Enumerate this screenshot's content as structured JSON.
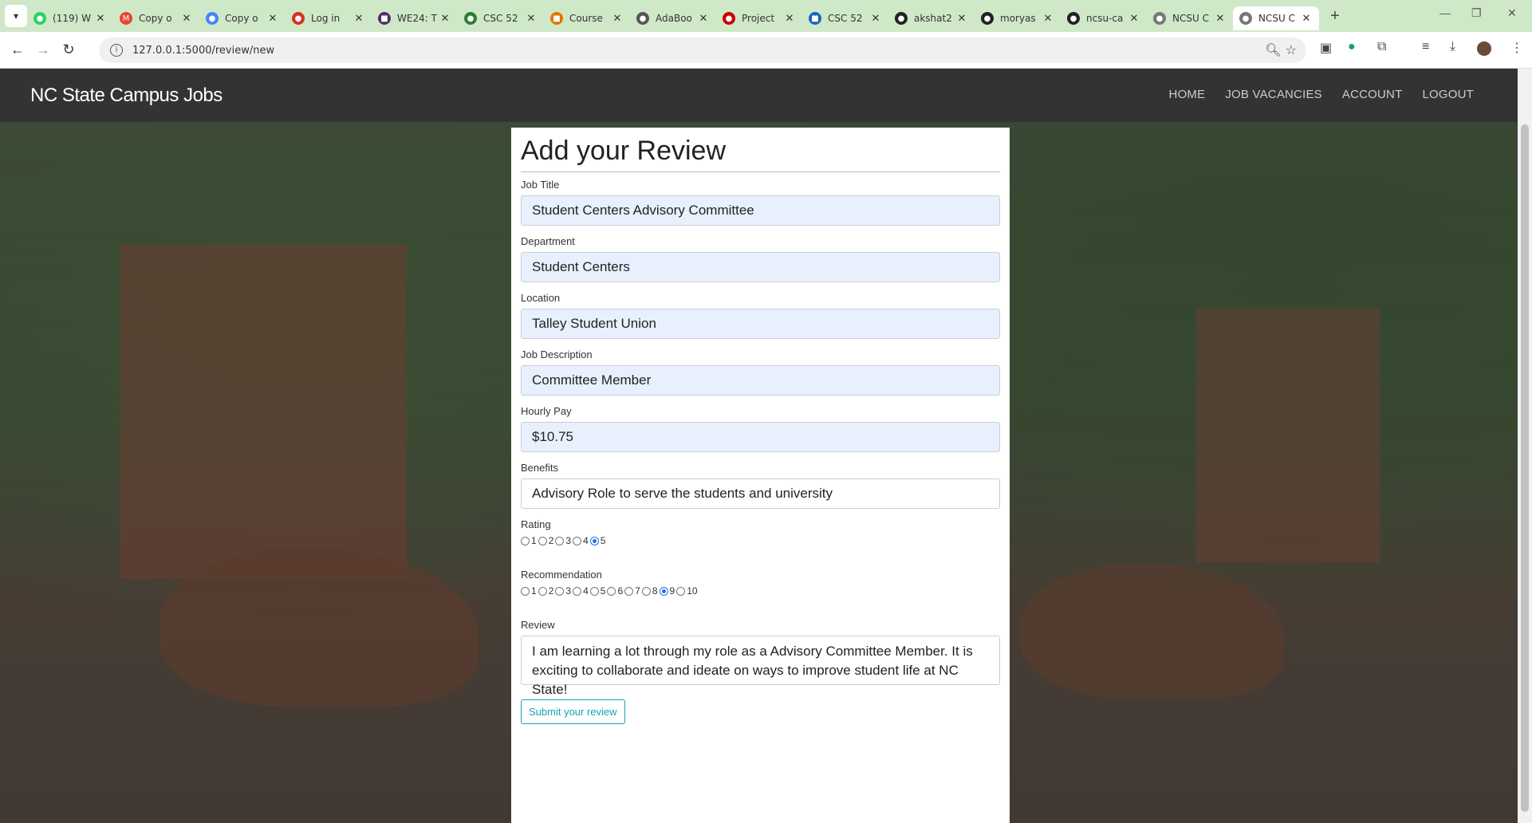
{
  "browser": {
    "tabs": [
      {
        "title": "(119) W",
        "color": "#25d366",
        "glyph": "●"
      },
      {
        "title": "Copy o",
        "color": "#ea4335",
        "glyph": "M"
      },
      {
        "title": "Copy o",
        "color": "#4285f4",
        "glyph": "●"
      },
      {
        "title": "Log in",
        "color": "#d93025",
        "glyph": "●"
      },
      {
        "title": "WE24: T",
        "color": "#512d6d",
        "glyph": "■"
      },
      {
        "title": "CSC 52",
        "color": "#2e7d32",
        "glyph": "●"
      },
      {
        "title": "Course",
        "color": "#e37400",
        "glyph": "■"
      },
      {
        "title": "AdaBoo",
        "color": "#555555",
        "glyph": "●"
      },
      {
        "title": "Project",
        "color": "#cc0000",
        "glyph": "●"
      },
      {
        "title": "CSC 52",
        "color": "#1565c0",
        "glyph": "■"
      },
      {
        "title": "akshat2",
        "color": "#222222",
        "glyph": "●"
      },
      {
        "title": "moryas",
        "color": "#222222",
        "glyph": "●"
      },
      {
        "title": "ncsu-ca",
        "color": "#222222",
        "glyph": "●"
      },
      {
        "title": "NCSU C",
        "color": "#777777",
        "glyph": "●"
      },
      {
        "title": "NCSU C",
        "color": "#777777",
        "glyph": "●"
      }
    ],
    "url": "127.0.0.1:5000/review/new"
  },
  "navbar": {
    "brand": "NC State Campus Jobs",
    "links": [
      "HOME",
      "JOB VACANCIES",
      "ACCOUNT",
      "LOGOUT"
    ]
  },
  "form": {
    "title": "Add your Review",
    "job_title": {
      "label": "Job Title",
      "value": "Student Centers Advisory Committee"
    },
    "department": {
      "label": "Department",
      "value": "Student Centers"
    },
    "location": {
      "label": "Location",
      "value": "Talley Student Union"
    },
    "description": {
      "label": "Job Description",
      "value": "Committee Member"
    },
    "pay": {
      "label": "Hourly Pay",
      "value": "$10.75"
    },
    "benefits": {
      "label": "Benefits",
      "value": "Advisory Role to serve the students and university"
    },
    "rating": {
      "label": "Rating",
      "options": [
        "1",
        "2",
        "3",
        "4",
        "5"
      ],
      "selected": "5"
    },
    "recommendation": {
      "label": "Recommendation",
      "options": [
        "1",
        "2",
        "3",
        "4",
        "5",
        "6",
        "7",
        "8",
        "9",
        "10"
      ],
      "selected": "9"
    },
    "review": {
      "label": "Review",
      "value": "I am learning a lot through my role as a Advisory Committee Member. It is exciting to collaborate and ideate on ways to improve student life at NC State!"
    },
    "submit_label": "Submit your review"
  }
}
